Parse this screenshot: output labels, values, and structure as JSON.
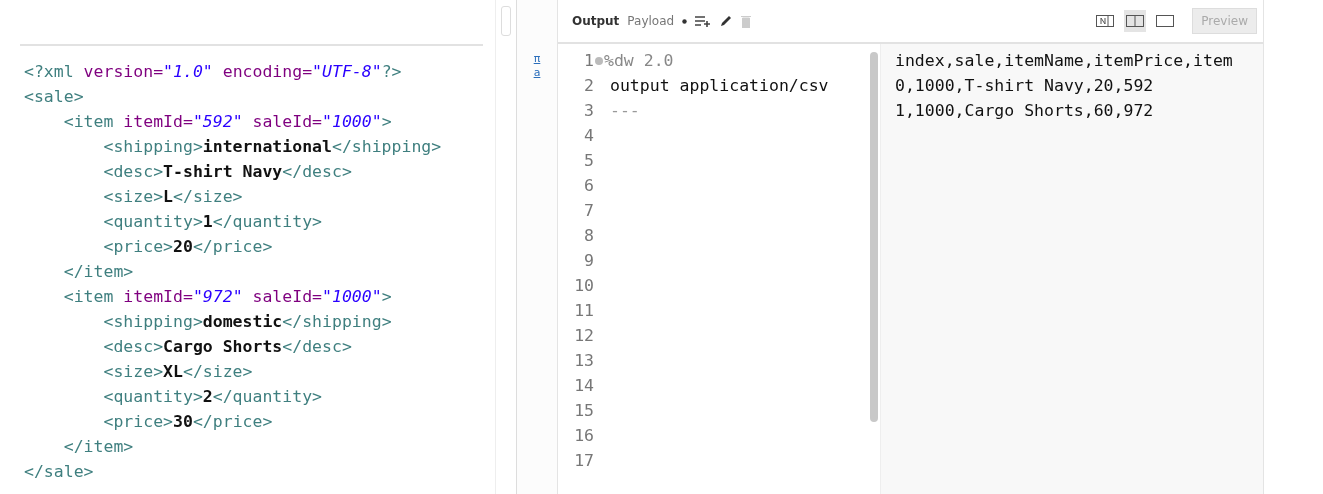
{
  "input_editor": {
    "lines": [
      [
        {
          "kind": "tag",
          "text": "<?xml "
        },
        {
          "kind": "attr",
          "text": "version="
        },
        {
          "kind": "value",
          "text": "\"1.0\""
        },
        {
          "kind": "attr",
          "text": " encoding="
        },
        {
          "kind": "value",
          "text": "\"UTF-8\""
        },
        {
          "kind": "tag",
          "text": "?>"
        }
      ],
      [
        {
          "kind": "tag",
          "text": "<sale>"
        }
      ],
      [
        {
          "kind": "tag",
          "text": "    <item "
        },
        {
          "kind": "attr",
          "text": "itemId="
        },
        {
          "kind": "value",
          "text": "\"592\""
        },
        {
          "kind": "attr",
          "text": " saleId="
        },
        {
          "kind": "value",
          "text": "\"1000\""
        },
        {
          "kind": "tag",
          "text": ">"
        }
      ],
      [
        {
          "kind": "tag",
          "text": "        <shipping>"
        },
        {
          "kind": "text",
          "text": "international"
        },
        {
          "kind": "tag",
          "text": "</shipping>"
        }
      ],
      [
        {
          "kind": "tag",
          "text": "        <desc>"
        },
        {
          "kind": "text",
          "text": "T-shirt Navy"
        },
        {
          "kind": "tag",
          "text": "</desc>"
        }
      ],
      [
        {
          "kind": "tag",
          "text": "        <size>"
        },
        {
          "kind": "text",
          "text": "L"
        },
        {
          "kind": "tag",
          "text": "</size>"
        }
      ],
      [
        {
          "kind": "tag",
          "text": "        <quantity>"
        },
        {
          "kind": "text",
          "text": "1"
        },
        {
          "kind": "tag",
          "text": "</quantity>"
        }
      ],
      [
        {
          "kind": "tag",
          "text": "        <price>"
        },
        {
          "kind": "text",
          "text": "20"
        },
        {
          "kind": "tag",
          "text": "</price>"
        }
      ],
      [
        {
          "kind": "tag",
          "text": "    </item>"
        }
      ],
      [
        {
          "kind": "tag",
          "text": "    <item "
        },
        {
          "kind": "attr",
          "text": "itemId="
        },
        {
          "kind": "value",
          "text": "\"972\""
        },
        {
          "kind": "attr",
          "text": " saleId="
        },
        {
          "kind": "value",
          "text": "\"1000\""
        },
        {
          "kind": "tag",
          "text": ">"
        }
      ],
      [
        {
          "kind": "tag",
          "text": "        <shipping>"
        },
        {
          "kind": "text",
          "text": "domestic"
        },
        {
          "kind": "tag",
          "text": "</shipping>"
        }
      ],
      [
        {
          "kind": "tag",
          "text": "        <desc>"
        },
        {
          "kind": "text",
          "text": "Cargo Shorts"
        },
        {
          "kind": "tag",
          "text": "</desc>"
        }
      ],
      [
        {
          "kind": "tag",
          "text": "        <size>"
        },
        {
          "kind": "text",
          "text": "XL"
        },
        {
          "kind": "tag",
          "text": "</size>"
        }
      ],
      [
        {
          "kind": "tag",
          "text": "        <quantity>"
        },
        {
          "kind": "text",
          "text": "2"
        },
        {
          "kind": "tag",
          "text": "</quantity>"
        }
      ],
      [
        {
          "kind": "tag",
          "text": "        <price>"
        },
        {
          "kind": "text",
          "text": "30"
        },
        {
          "kind": "tag",
          "text": "</price>"
        }
      ],
      [
        {
          "kind": "tag",
          "text": "    </item>"
        }
      ],
      [
        {
          "kind": "tag",
          "text": "</sale>"
        }
      ]
    ]
  },
  "side_links": [
    "π",
    "a"
  ],
  "toolbar": {
    "label": "Output",
    "target": "Payload",
    "layout_buttons": [
      {
        "kind": "text",
        "selected": false
      },
      {
        "kind": "split",
        "selected": true
      },
      {
        "kind": "single",
        "selected": false
      }
    ],
    "preview": {
      "label": "Preview",
      "disabled": true
    }
  },
  "script_editor": {
    "lines": [
      {
        "number": "1",
        "text": "%dw 2.0",
        "kind": "directive",
        "folded": false
      },
      {
        "number": "2",
        "text": "output application/csv",
        "kind": "code"
      },
      {
        "number": "3",
        "text": "---",
        "kind": "separator"
      },
      {
        "number": "4"
      },
      {
        "number": "5"
      },
      {
        "number": "6"
      },
      {
        "number": "7"
      },
      {
        "number": "8"
      },
      {
        "number": "9"
      },
      {
        "number": "10"
      },
      {
        "number": "11"
      },
      {
        "number": "12"
      },
      {
        "number": "13"
      },
      {
        "number": "14"
      },
      {
        "number": "15"
      },
      {
        "number": "16"
      },
      {
        "number": "17"
      }
    ]
  },
  "output_preview": {
    "lines": [
      "index,sale,itemName,itemPrice,item",
      "0,1000,T-shirt Navy,20,592",
      "1,1000,Cargo Shorts,60,972"
    ]
  }
}
